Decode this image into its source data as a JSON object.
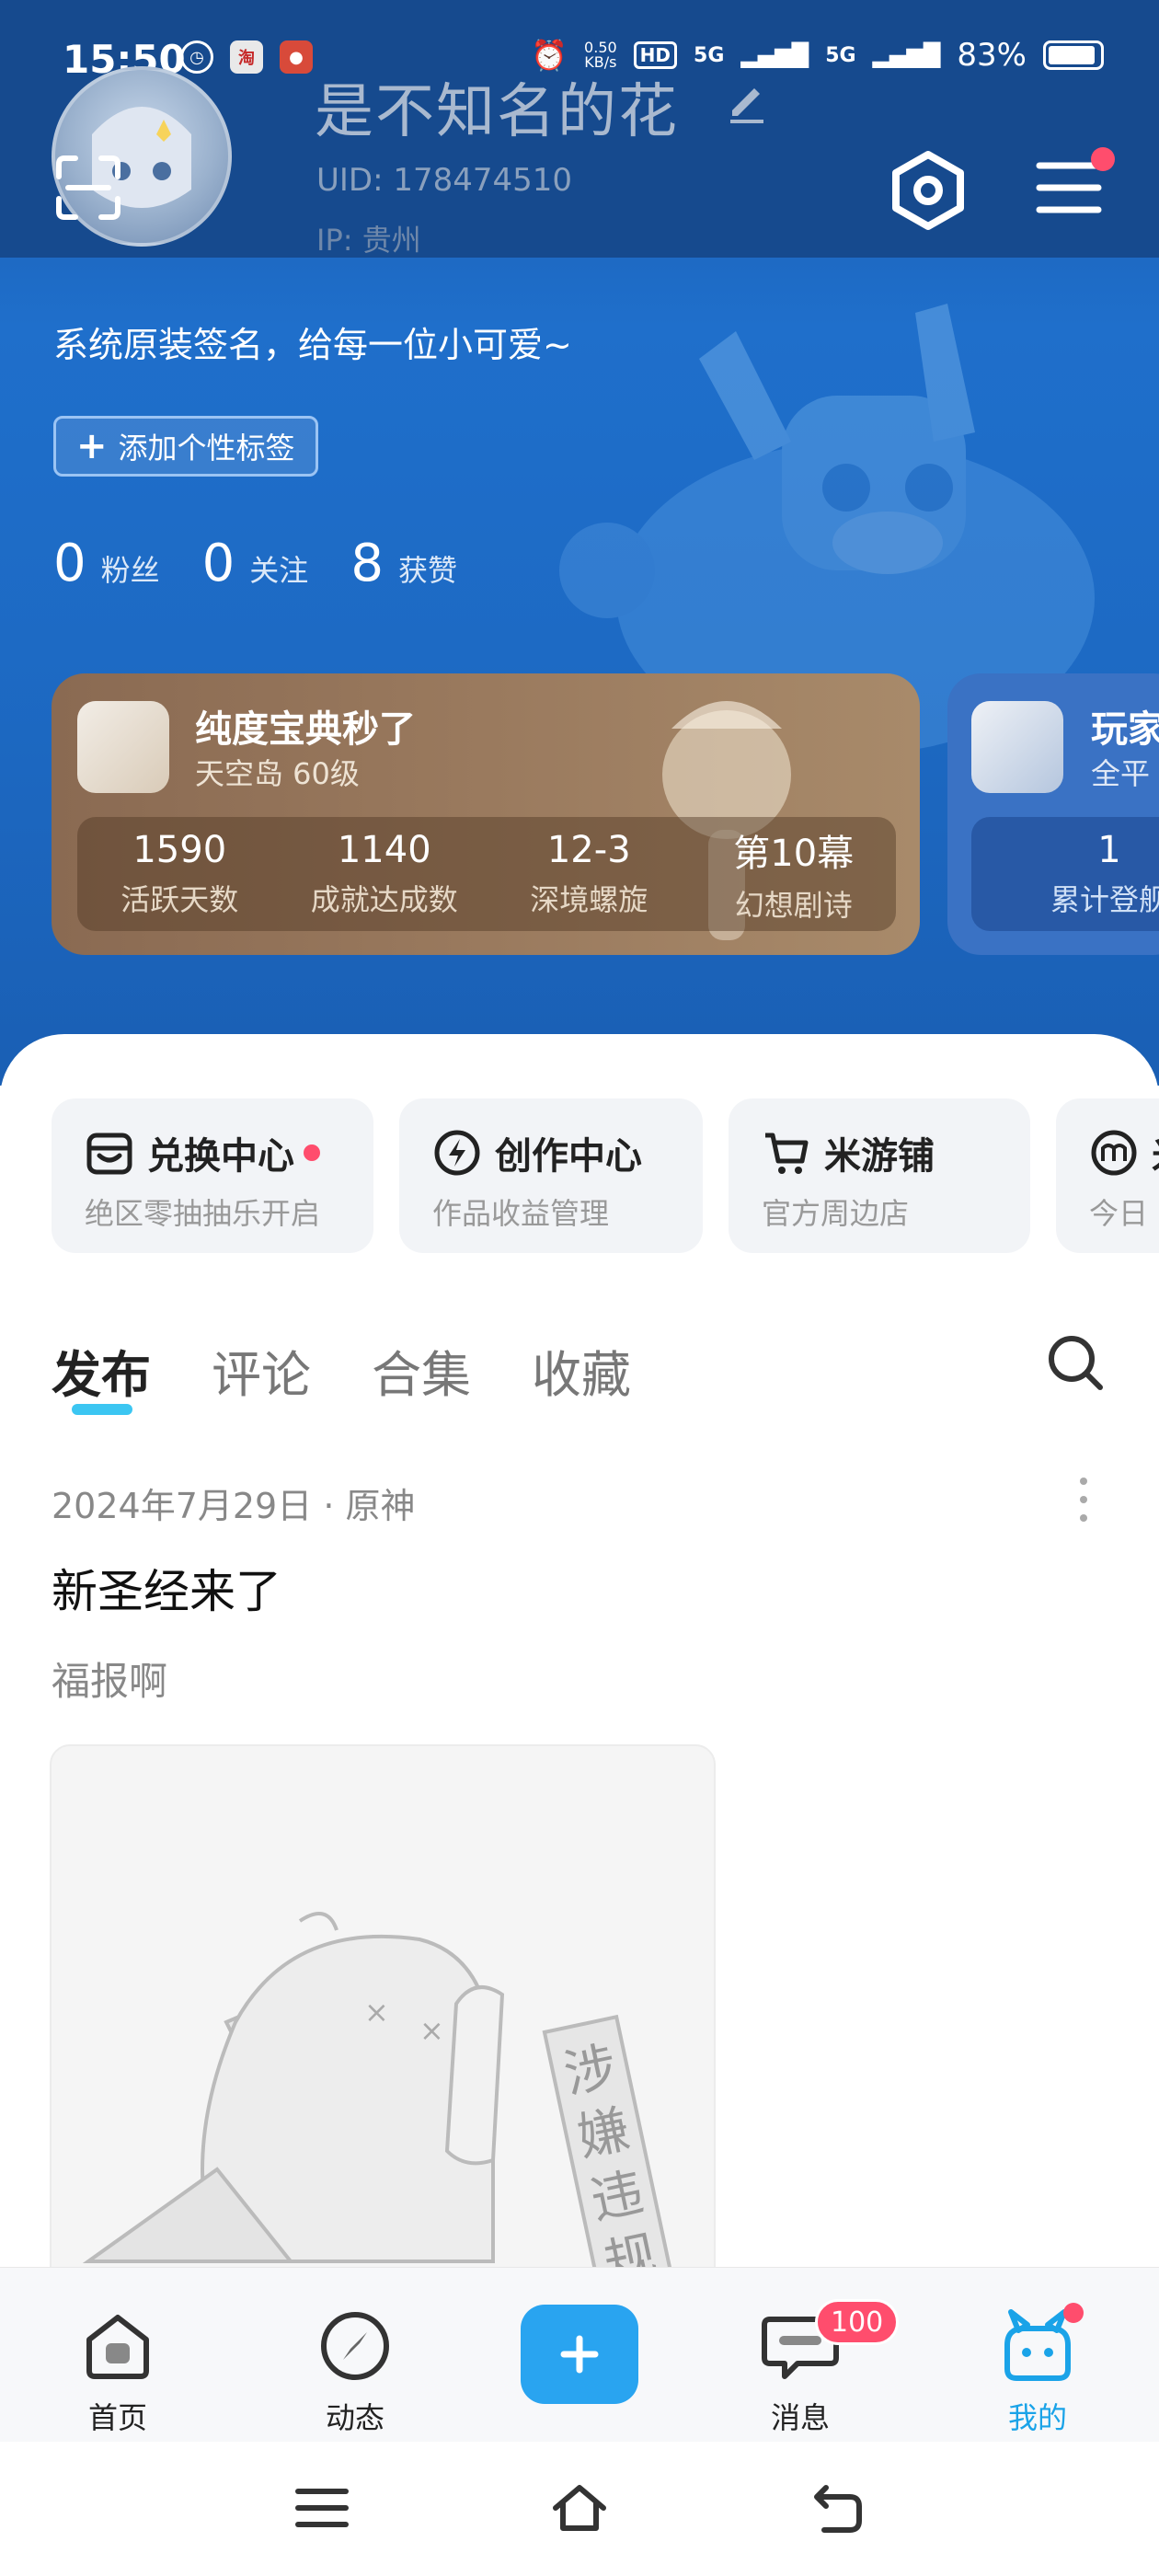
{
  "status_bar": {
    "time": "15:50",
    "app_icon_1": "淘",
    "network_speed_value": "0.50",
    "network_speed_unit": "KB/s",
    "hd": "HD",
    "signal_1": "5G",
    "signal_2": "5G",
    "battery": "83%",
    "battery_level": 0.83
  },
  "profile": {
    "username": "是不知名的花",
    "uid": "UID: 178474510",
    "ip": "IP: 贵州",
    "signature": "系统原装签名，给每一位小可爱~",
    "add_tag_label": "添加个性标签",
    "add_tag_icon": "plus-icon"
  },
  "stats": [
    {
      "num": "0",
      "label": "粉丝"
    },
    {
      "num": "0",
      "label": "关注"
    },
    {
      "num": "8",
      "label": "获赞"
    }
  ],
  "game_cards": [
    {
      "name": "纯度宝典秒了",
      "server": "天空岛 60级",
      "stats": [
        {
          "value": "1590",
          "label": "活跃天数"
        },
        {
          "value": "1140",
          "label": "成就达成数"
        },
        {
          "value": "12-3",
          "label": "深境螺旋"
        },
        {
          "value": "第10幕",
          "label": "幻想剧诗"
        }
      ]
    },
    {
      "name": "玩家",
      "server": "全平",
      "stats": [
        {
          "value": "1",
          "label": "累计登舰"
        }
      ]
    }
  ],
  "services": [
    {
      "title": "兑换中心",
      "desc": "绝区零抽抽乐开启",
      "icon": "shop-icon",
      "dot": true
    },
    {
      "title": "创作中心",
      "desc": "作品收益管理",
      "icon": "lightning-icon",
      "dot": false
    },
    {
      "title": "米游铺",
      "desc": "官方周边店",
      "icon": "cart-icon",
      "dot": false
    },
    {
      "title": "米",
      "desc": "今日",
      "icon": "m-icon",
      "dot": false
    }
  ],
  "tabs": [
    "发布",
    "评论",
    "合集",
    "收藏"
  ],
  "active_tab": "发布",
  "post": {
    "meta": "2024年7月29日 · 原神",
    "title": "新圣经来了",
    "body": "福报啊",
    "image_stamp": "涉嫌违规"
  },
  "bottom_nav": [
    {
      "label": "首页",
      "icon": "home-icon"
    },
    {
      "label": "动态",
      "icon": "compass-icon"
    },
    {
      "label": "",
      "icon": "plus-icon"
    },
    {
      "label": "消息",
      "icon": "message-icon"
    },
    {
      "label": "我的",
      "icon": "profile-icon"
    }
  ],
  "message_badge": "100",
  "colors": {
    "accent": "#29a4f0",
    "hero_blue": "#1f6fcb",
    "badge_red": "#ff4d6d",
    "tab_indicator": "#3cc6f2"
  }
}
